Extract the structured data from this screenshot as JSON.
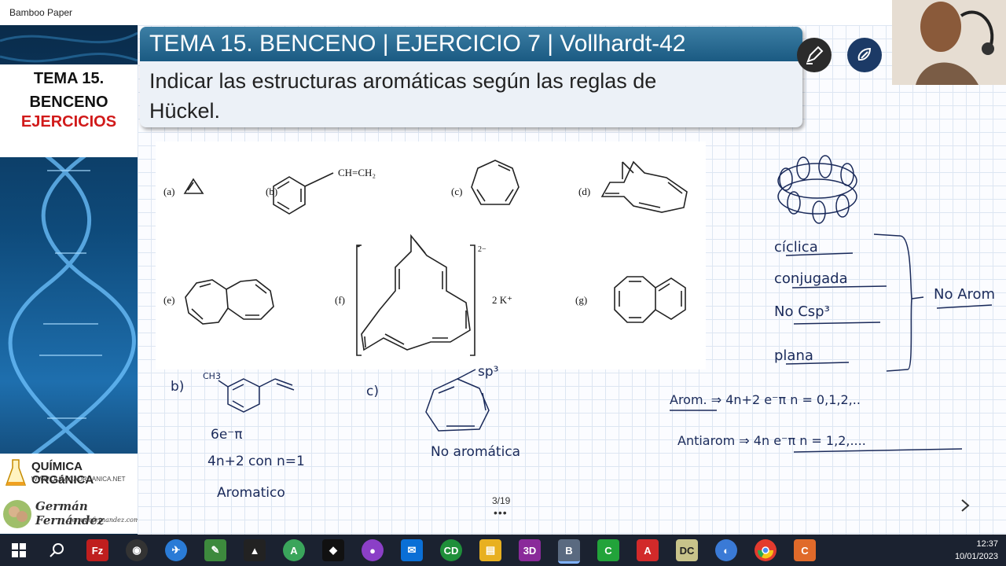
{
  "window": {
    "app_title": "Bamboo Paper"
  },
  "sidebar": {
    "course_title_1": "TEMA 15.",
    "course_title_2": "BENCENO",
    "course_title_3": "EJERCICIOS",
    "site_name": "QUÍMICA ORGáNICA",
    "site_url": "WWW.QUIMICAORGANICA.NET",
    "author_name": "Germán Fernández",
    "author_site": "Germanfernandez.com"
  },
  "banner": {
    "heading": "TEMA 15. BENCENO | EJERCICIO 7 | Vollhardt-42",
    "line1": "Indicar las estructuras aromáticas según las reglas de",
    "line2": "Hückel."
  },
  "figure": {
    "labels": [
      "(a)",
      "(b)",
      "(c)",
      "(d)",
      "(e)",
      "(f)",
      "(g)"
    ],
    "substituent_b": "CH=CH₂",
    "charge_f": "2−",
    "counterion_f": "2 K⁺"
  },
  "handwriting": {
    "b_label": "b)",
    "b_methyl": "CH3",
    "b_electrons": "6e⁻π",
    "b_rule": "4n+2 con n=1",
    "b_result": "Aromatico",
    "c_label": "c)",
    "c_sp3": "sp³",
    "c_result": "No aromática",
    "criteria": [
      "cíclica",
      "conjugada",
      "No Csp³",
      "plana"
    ],
    "criteria_result": "No Arom",
    "arom_rule": "Arom. ⇒ 4n+2 e⁻π   n = 0,1,2,..",
    "antiarom_rule": "Antiarom ⇒ 4n e⁻π   n = 1,2,...."
  },
  "pager": {
    "page": "3/19",
    "more": "•••"
  },
  "taskbar": {
    "time": "12:37",
    "date": "10/01/2023",
    "icons": [
      "windows-start",
      "search",
      "filezilla",
      "davinci",
      "thunderbird",
      "notepad",
      "inkscape",
      "android-studio",
      "unity",
      "tor",
      "mail",
      "chemdraw",
      "file-explorer",
      "3d-builder",
      "bamboo-paper",
      "camtasia",
      "acrobat",
      "dxc",
      "other",
      "chrome",
      "camtasia-2"
    ]
  },
  "colors": {
    "banner_head": "#1a5a82",
    "ink": "#1a2a5a",
    "accent_red": "#d11a1a",
    "taskbar": "#1b2230"
  }
}
